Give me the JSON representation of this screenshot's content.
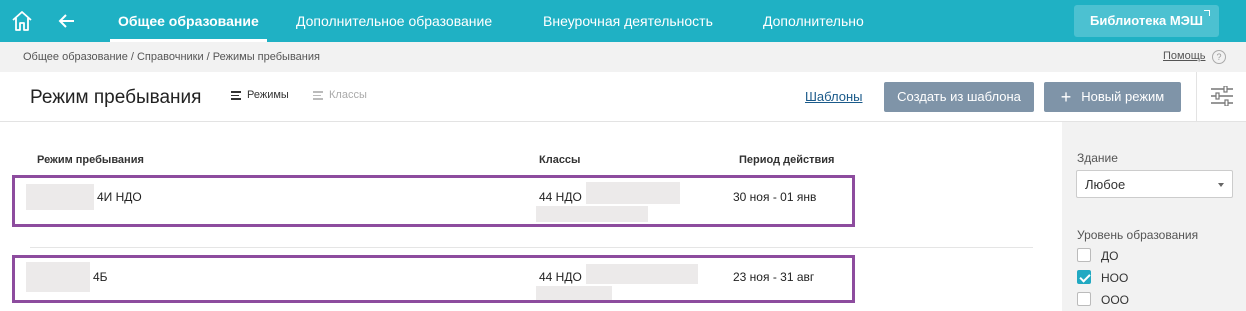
{
  "nav": {
    "tabs": [
      {
        "label": "Общее образование",
        "active": true
      },
      {
        "label": "Дополнительное образование",
        "active": false
      },
      {
        "label": "Внеурочная деятельность",
        "active": false
      },
      {
        "label": "Дополнительно",
        "active": false
      }
    ],
    "library_button": "Библиотека МЭШ",
    "accent": "#1fb1c4"
  },
  "breadcrumb": "Общее образование / Справочники / Режимы пребывания",
  "help": {
    "label": "Помощь",
    "icon_text": "?"
  },
  "header": {
    "title": "Режим пребывания",
    "views": [
      {
        "label": "Режимы",
        "active": true
      },
      {
        "label": "Классы",
        "active": false
      }
    ],
    "templates_link": "Шаблоны",
    "create_from_template": "Создать из шаблона",
    "new_mode": "Новый режим",
    "new_mode_icon": "+"
  },
  "table": {
    "columns": [
      "Режим пребывания",
      "Классы",
      "Период действия"
    ],
    "rows": [
      {
        "name": "4И НДО",
        "classes": "44 НДО",
        "period": "30 ноя - 01 янв"
      },
      {
        "name": "4Б",
        "classes": "44 НДО",
        "period": "23 ноя - 31 авг"
      }
    ]
  },
  "filters": {
    "building_label": "Здание",
    "building_value": "Любое",
    "level_label": "Уровень образования",
    "levels": [
      {
        "label": "ДО",
        "checked": false
      },
      {
        "label": "НОО",
        "checked": true
      },
      {
        "label": "ООО",
        "checked": false
      }
    ]
  }
}
